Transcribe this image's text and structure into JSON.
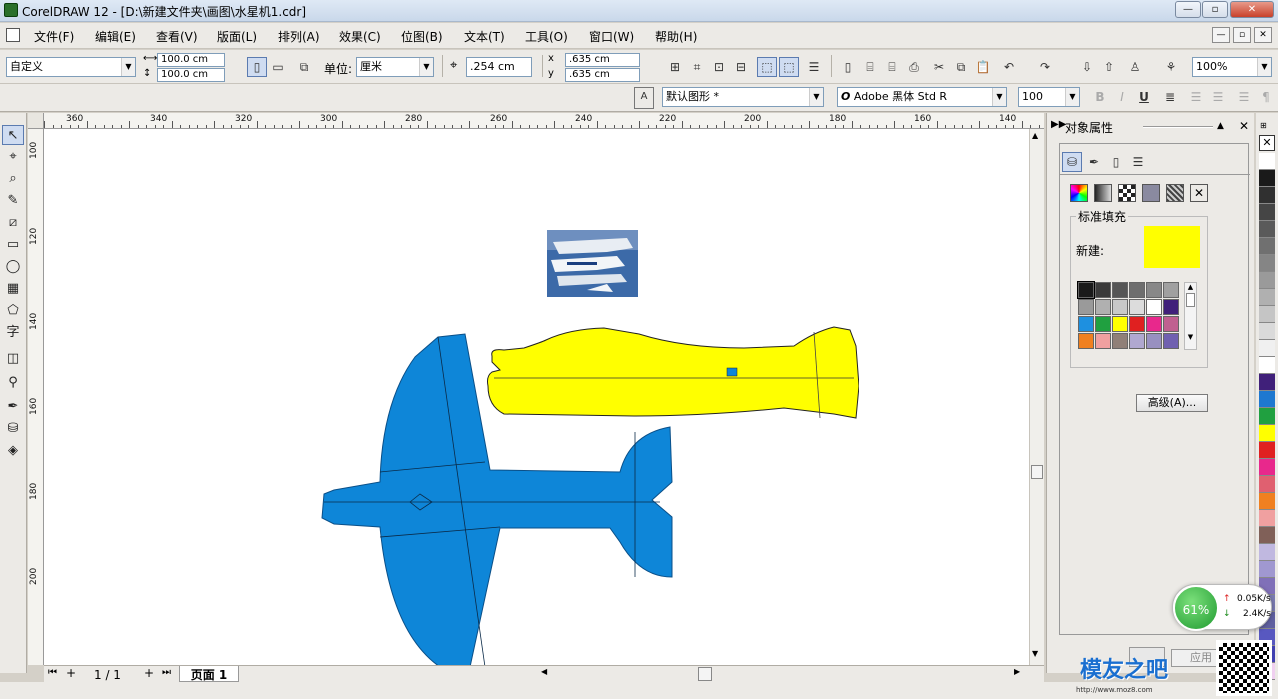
{
  "window": {
    "title": "CorelDRAW 12 - [D:\\新建文件夹\\画图\\水星机1.cdr]",
    "min": "—",
    "max": "▫",
    "close": "✕"
  },
  "menu": [
    "文件(F)",
    "编辑(E)",
    "查看(V)",
    "版面(L)",
    "排列(A)",
    "效果(C)",
    "位图(B)",
    "文本(T)",
    "工具(O)",
    "窗口(W)",
    "帮助(H)"
  ],
  "property_bar": {
    "paper_preset": "自定义",
    "width": "100.0 cm",
    "height": "100.0 cm",
    "units_label": "单位:",
    "units": "厘米",
    "nudge": ".254 cm",
    "dup_x": ".635 cm",
    "dup_y": ".635 cm",
    "zoom": "100%"
  },
  "text_bar": {
    "style": "默认图形 *",
    "font": "Adobe 黑体 Std R",
    "size": "100",
    "bold": "B",
    "italic": "I",
    "underline": "U",
    "font_icon": "O"
  },
  "rulers": {
    "h_labels": [
      "360",
      "340",
      "320",
      "300",
      "280",
      "260",
      "240",
      "220",
      "200",
      "180",
      "160",
      "140"
    ],
    "v_labels": [
      "100",
      "120",
      "140",
      "160",
      "180",
      "200"
    ]
  },
  "docker": {
    "title": "对象属性",
    "section": "标准填充",
    "new_label": "新建:",
    "advanced_button": "高级(A)...",
    "apply_button": "应用"
  },
  "colors": {
    "fill_yellow": "#ffff00",
    "plane_blue": "#0e86d8",
    "grid": [
      "#1a1a1a",
      "#3a3a3a",
      "#555555",
      "#6e6e6e",
      "#888888",
      "#a0a0a0",
      "#9a9a9a",
      "#b0b0b0",
      "#c8c8c8",
      "#dcdcdc",
      "#ffffff",
      "#40207a",
      "#1e90e0",
      "#20a040",
      "#ffff00",
      "#e02020",
      "#e8288c",
      "#c06090",
      "#f08020",
      "#f0a0a0",
      "#908078",
      "#b0a8d0",
      "#9890c0",
      "#7060b0"
    ],
    "palette": [
      "#ffffff",
      "#1a1a1a",
      "#303030",
      "#454545",
      "#5a5a5a",
      "#707070",
      "#858585",
      "#9a9a9a",
      "#b0b0b0",
      "#c5c5c5",
      "#dadada",
      "#f0f0f0",
      "#ffffff",
      "#40207a",
      "#1e78d0",
      "#20a040",
      "#ffff00",
      "#e02020",
      "#e8288c",
      "#e06070",
      "#f08020",
      "#f0a0a0",
      "#806058",
      "#c0b8e0",
      "#a098d0",
      "#8070b8",
      "#7a7ab0",
      "#6060a0",
      "#5858c0",
      "#4040b0",
      "#f0d0f0"
    ]
  },
  "pagenav": {
    "count": "1 / 1",
    "page_tab": "页面 1"
  },
  "network": {
    "percent": "61%",
    "up": "0.05K/s",
    "down": "2.4K/s"
  },
  "watermark": {
    "text": "模友之吧",
    "url": "http://www.moz8.com"
  }
}
